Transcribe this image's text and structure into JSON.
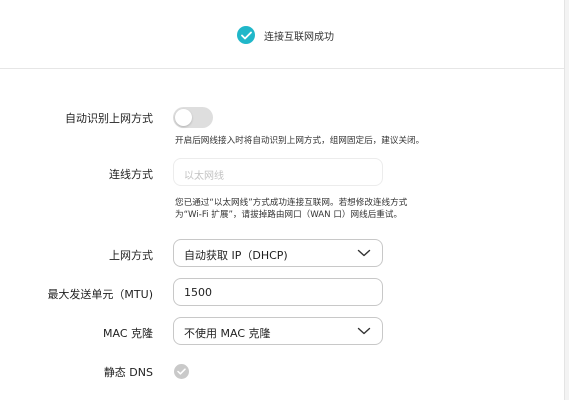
{
  "banner": {
    "status_text": "连接互联网成功",
    "accent_color": "#20b7c9"
  },
  "form": {
    "auto_detect": {
      "label": "自动识别上网方式",
      "enabled": false,
      "hint": "开启后网线接入时将自动识别上网方式，组网固定后，建议关闭。"
    },
    "connection_mode": {
      "label": "连线方式",
      "value": "以太网线",
      "disabled": true,
      "hint_line1": "您已通过“以太网线”方式成功连接互联网。若想修改连线方式",
      "hint_line2": "为“Wi-Fi 扩展”，请拔掉路由网口（WAN 口）网线后重试。"
    },
    "internet_mode": {
      "label": "上网方式",
      "value": "自动获取 IP（DHCP)"
    },
    "mtu": {
      "label": "最大发送单元（MTU)",
      "value": "1500"
    },
    "mac_clone": {
      "label": "MAC 克隆",
      "value": "不使用 MAC 克隆"
    },
    "static_dns": {
      "label": "静态 DNS",
      "checked": false
    }
  },
  "icons": {
    "success": "check-circle-icon",
    "dropdown": "chevron-down-icon",
    "checkbox": "check-circle-icon"
  }
}
